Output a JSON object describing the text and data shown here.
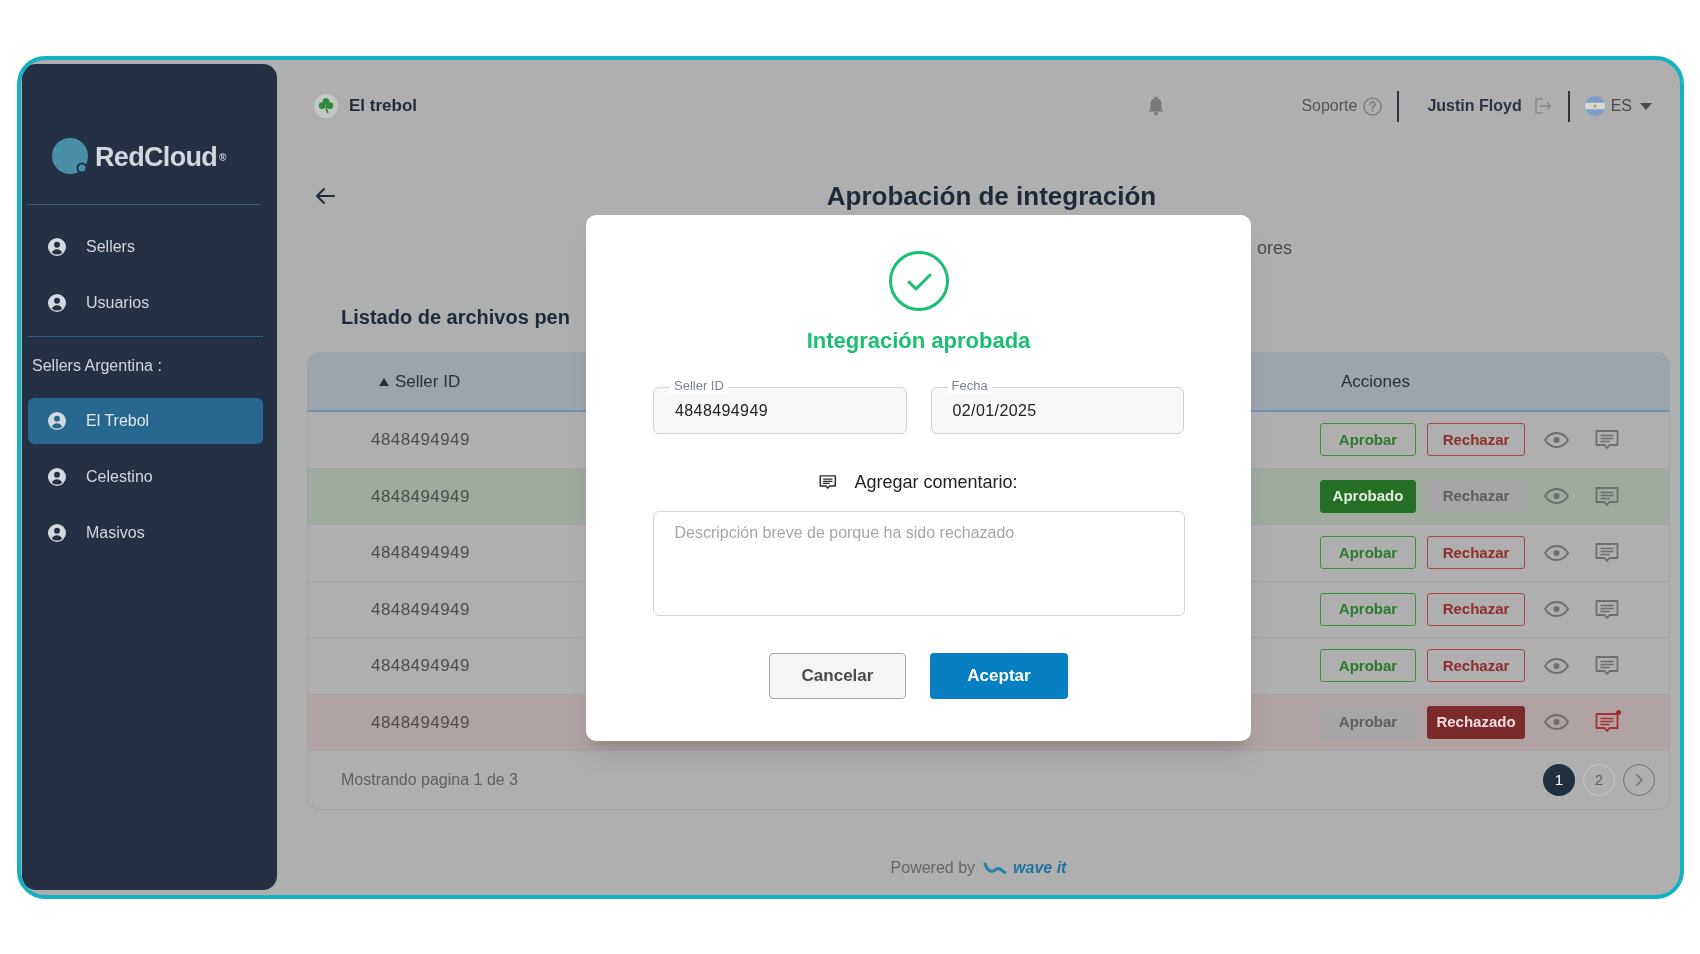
{
  "sidebar": {
    "logo_text": "RedCloud$^{®}$",
    "items": [
      {
        "label": "Sellers",
        "selected": false
      },
      {
        "label": "Usuarios",
        "selected": false
      }
    ],
    "section_title": "Sellers Argentina :",
    "section_items": [
      {
        "label": "El Trebol",
        "selected": true
      },
      {
        "label": "Celestino",
        "selected": false
      },
      {
        "label": "Masivos",
        "selected": false
      }
    ]
  },
  "header": {
    "store_name": "El trebol",
    "support_label": "Soporte",
    "user_name": "Justin Floyd",
    "language": "ES"
  },
  "page": {
    "title": "Aprobación de integración",
    "subtitle": "ores",
    "list_title": "Listado de archivos pen"
  },
  "table": {
    "columns": [
      {
        "label": "Seller ID",
        "sorted": true
      },
      {
        "label": "Acciones",
        "sorted": false
      }
    ],
    "rows": [
      {
        "seller_id": "4848494949",
        "approved": false,
        "rejected": false,
        "approve_label": "Aprobar",
        "reject_label": "Rechazar",
        "new_comment": false
      },
      {
        "seller_id": "4848494949",
        "approved": true,
        "rejected": false,
        "approve_label": "Aprobado",
        "reject_label": "Rechazar",
        "new_comment": false
      },
      {
        "seller_id": "4848494949",
        "approved": false,
        "rejected": false,
        "approve_label": "Aprobar",
        "reject_label": "Rechazar",
        "new_comment": false
      },
      {
        "seller_id": "4848494949",
        "approved": false,
        "rejected": false,
        "approve_label": "Aprobar",
        "reject_label": "Rechazar",
        "new_comment": false
      },
      {
        "seller_id": "4848494949",
        "approved": false,
        "rejected": false,
        "approve_label": "Aprobar",
        "reject_label": "Rechazar",
        "new_comment": false
      },
      {
        "seller_id": "4848494949",
        "approved": false,
        "rejected": true,
        "approve_label": "Aprobar",
        "reject_label": "Rechazado",
        "new_comment": true
      }
    ],
    "footer": {
      "summary": "Mostrando pagina 1 de 3",
      "pages": [
        {
          "label": "1",
          "selected": true
        },
        {
          "label": "2",
          "selected": false
        }
      ]
    }
  },
  "footer": {
    "powered_by": "Powered by",
    "brand": "wave it"
  },
  "dialog": {
    "title": "Integración aprobada",
    "fields": [
      {
        "label": "Seller ID",
        "value": "4848494949"
      },
      {
        "label": "Fecha",
        "value": "02/01/2025"
      }
    ],
    "comment": {
      "label": "Agregar comentario:",
      "placeholder": "Descripción breve de porque ha sido rechazado"
    },
    "buttons": [
      {
        "label": "Cancelar",
        "kind": "secondary"
      },
      {
        "label": "Aceptar",
        "kind": "primary"
      }
    ]
  }
}
